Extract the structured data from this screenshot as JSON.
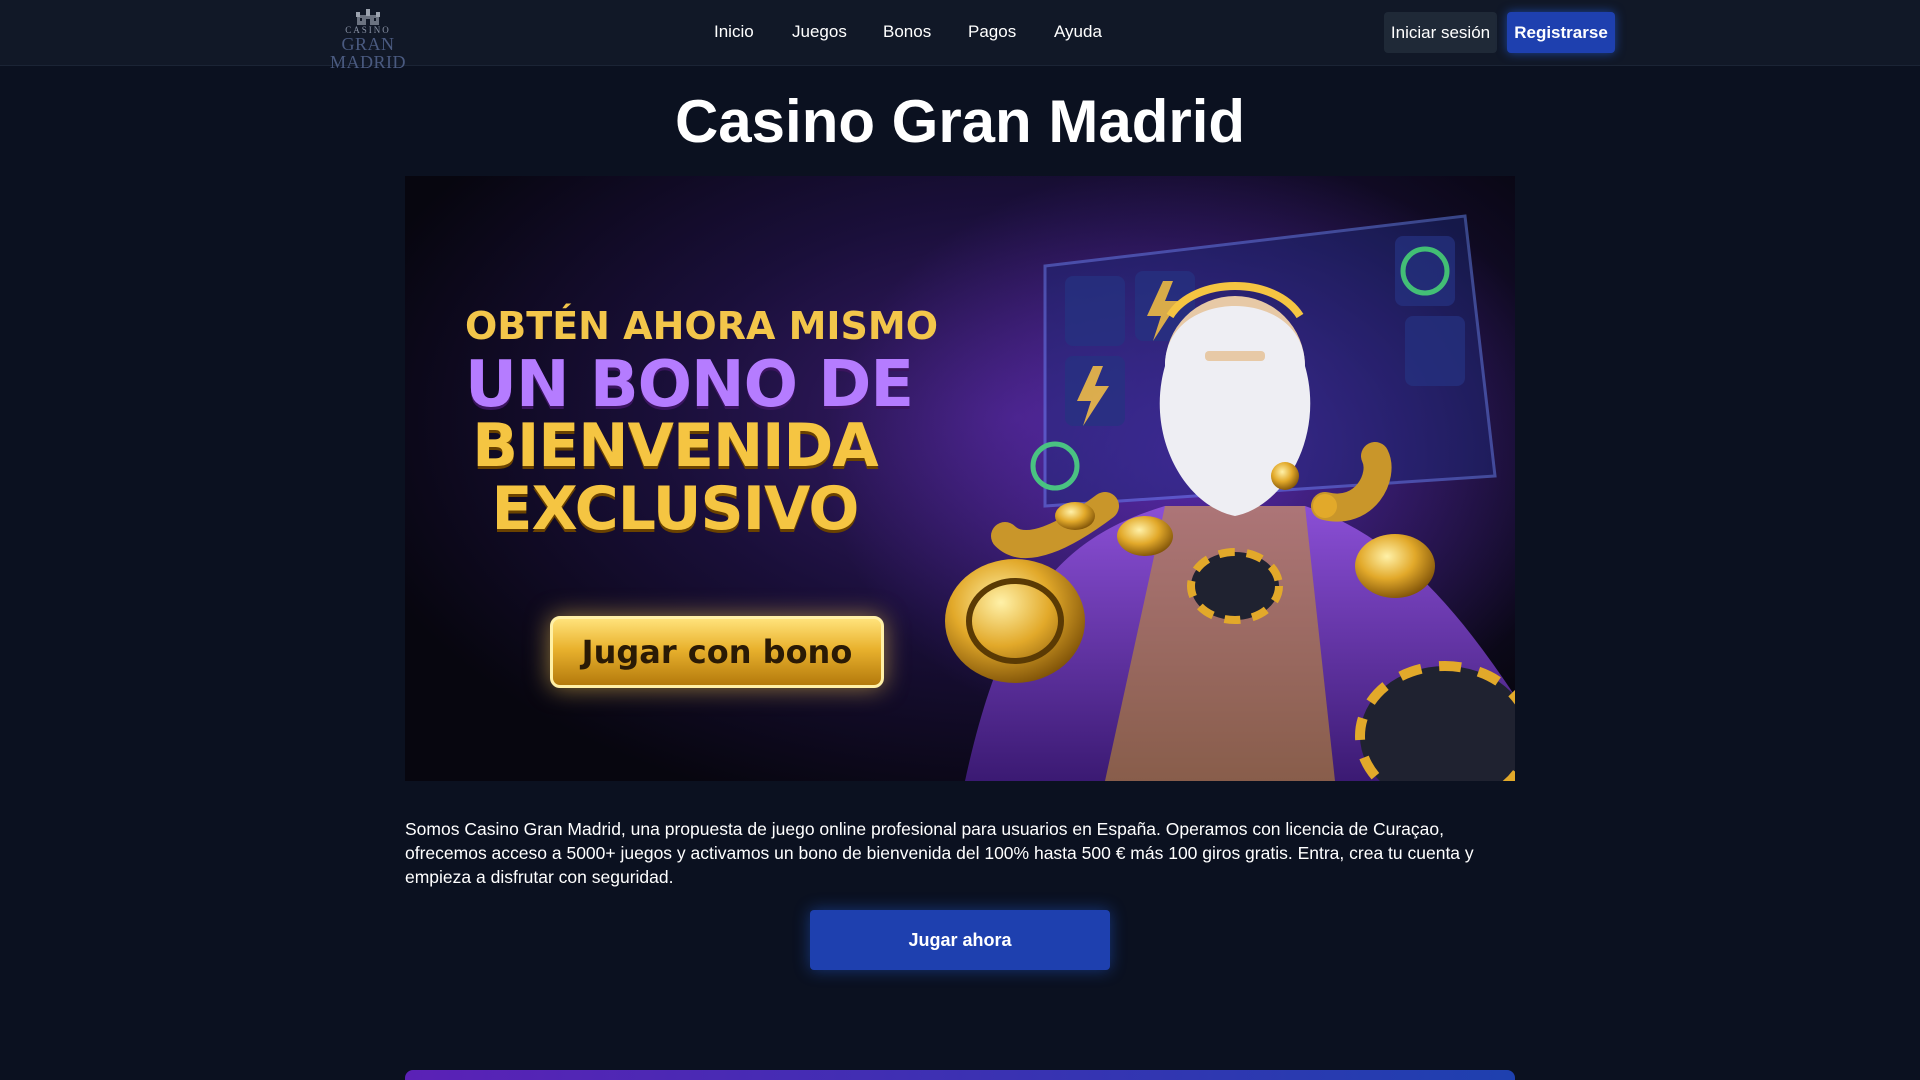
{
  "header": {
    "logo": {
      "small_text": "CASINO",
      "big_text": "GRAN MADRID",
      "icon": "castle-crest-icon"
    },
    "nav": [
      {
        "label": "Inicio"
      },
      {
        "label": "Juegos"
      },
      {
        "label": "Bonos"
      },
      {
        "label": "Pagos"
      },
      {
        "label": "Ayuda"
      }
    ],
    "login_label": "Iniciar sesión",
    "register_label": "Registrarse"
  },
  "main": {
    "title": "Casino Gran Madrid",
    "banner": {
      "line1": "OBTÉN AHORA MISMO",
      "line2": "UN BONO DE",
      "line3": "BIENVENIDA",
      "line4": "EXCLUSIVO",
      "button_label": "Jugar con bono"
    },
    "intro": "Somos Casino Gran Madrid, una propuesta de juego online profesional para usuarios en España. Operamos con licencia de Curaçao, ofrecemos acceso a 5000+ juegos y activamos un bono de bienvenida del 100% hasta 500 € más 100 giros gratis. Entra, crea tu cuenta y empieza a disfrutar con seguridad.",
    "cta_label": "Jugar ahora"
  },
  "colors": {
    "background": "#0b1120",
    "header": "#111827",
    "primary": "#1e40af",
    "gold": "#f5c542",
    "purple": "#b57cff"
  }
}
